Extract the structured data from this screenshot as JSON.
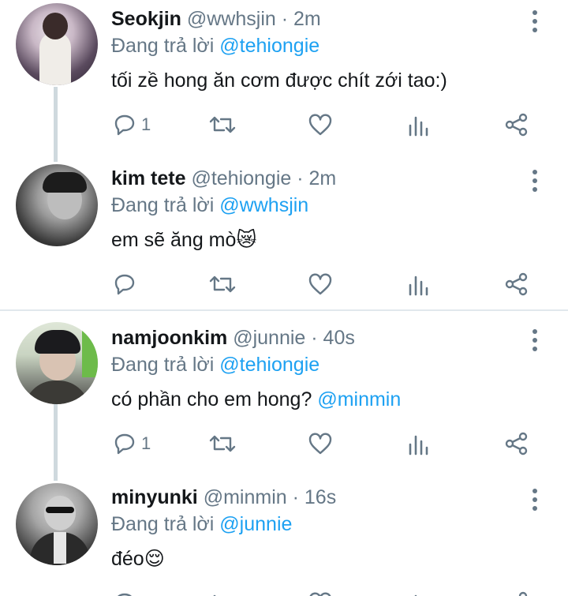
{
  "tweets": [
    {
      "name": "Seokjin",
      "handle": "@wwhsjin",
      "sep": "·",
      "time": "2m",
      "reply_prefix": "Đang trả lời",
      "reply_to": "@tehiongie",
      "text": "tối zề hong ăn cơm được chít zới tao:)",
      "reply_count": "1"
    },
    {
      "name": "kim tete",
      "handle": "@tehiongie",
      "sep": "·",
      "time": "2m",
      "reply_prefix": "Đang trả lời",
      "reply_to": "@wwhsjin",
      "text": "em sẽ ăng mò😿",
      "reply_count": ""
    },
    {
      "name": "namjoonkim",
      "handle": "@junnie",
      "sep": "·",
      "time": "40s",
      "reply_prefix": "Đang trả lời",
      "reply_to": "@tehiongie",
      "text": "có phần cho em hong?",
      "text_mention": "@minmin",
      "reply_count": "1"
    },
    {
      "name": "minyunki",
      "handle": "@minmin",
      "sep": "·",
      "time": "16s",
      "reply_prefix": "Đang trả lời",
      "reply_to": "@junnie",
      "text": "đéo😌",
      "reply_count": ""
    }
  ],
  "colors": {
    "accent": "#1da1f2",
    "muted": "#657786",
    "text": "#14171a",
    "divider": "#e1e8ed"
  },
  "icons": [
    "reply-icon",
    "retweet-icon",
    "like-icon",
    "analytics-icon",
    "share-icon",
    "more-vertical-icon"
  ]
}
